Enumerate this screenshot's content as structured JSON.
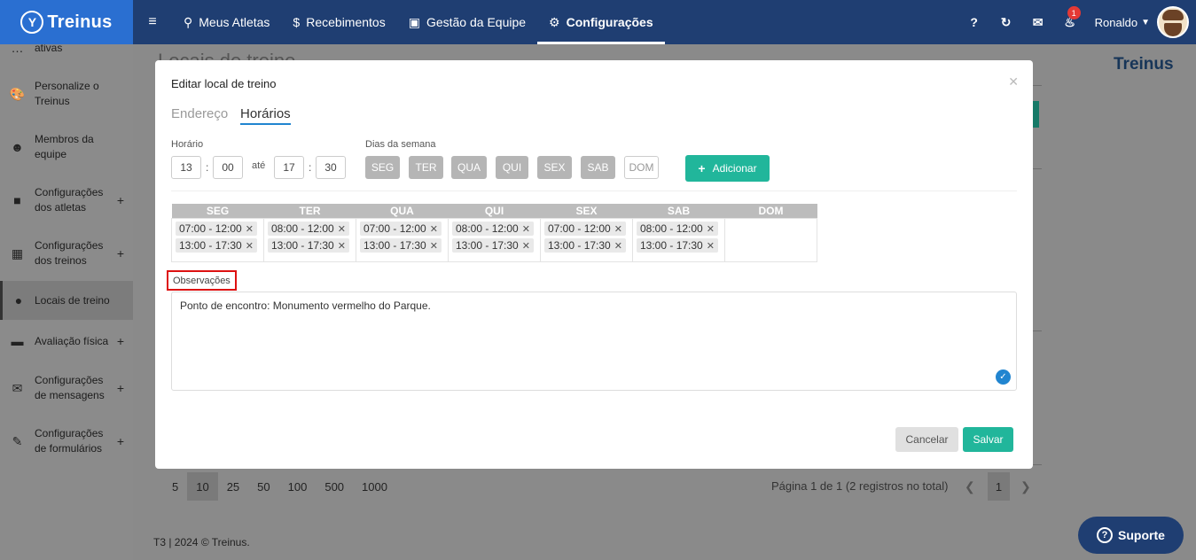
{
  "brand": {
    "name": "Treinus",
    "logo_icon": "treinus-logo-icon"
  },
  "nav": {
    "items": [
      {
        "label": "Meus Atletas",
        "icon": "medal-icon"
      },
      {
        "label": "Recebimentos",
        "icon": "dollar-icon"
      },
      {
        "label": "Gestão da Equipe",
        "icon": "id-card-icon"
      },
      {
        "label": "Configurações",
        "icon": "gears-icon"
      }
    ],
    "help": "?",
    "notifications_count": "1",
    "user_name": "Ronaldo"
  },
  "sidebar": {
    "items": [
      {
        "label": "ativas"
      },
      {
        "label": "Personalize o Treinus"
      },
      {
        "label": "Membros da equipe"
      },
      {
        "label": "Configurações dos atletas"
      },
      {
        "label": "Configurações dos treinos"
      },
      {
        "label": "Locais de treino"
      },
      {
        "label": "Avaliação física"
      },
      {
        "label": "Configurações de mensagens"
      },
      {
        "label": "Configurações de formulários"
      }
    ]
  },
  "background": {
    "title": "Locais de treino",
    "logo_text": "Treinus",
    "page_sizes": [
      "5",
      "10",
      "25",
      "50",
      "100",
      "500",
      "1000"
    ],
    "page_info": "Página 1 de 1 (2 registros no total)",
    "current_page": "1",
    "footer": "T3  | 2024 © Treinus.",
    "support": "Suporte"
  },
  "modal": {
    "title": "Editar local de treino",
    "tabs": [
      "Endereço",
      "Horários"
    ],
    "horario_label": "Horário",
    "start_hour": "13",
    "start_min": "00",
    "ate": "até",
    "end_hour": "17",
    "end_min": "30",
    "dias_label": "Dias da semana",
    "days": [
      "SEG",
      "TER",
      "QUA",
      "QUI",
      "SEX",
      "SAB",
      "DOM"
    ],
    "add_button": "Adicionar",
    "schedule": {
      "headers": [
        "SEG",
        "TER",
        "QUA",
        "QUI",
        "SEX",
        "SAB",
        "DOM"
      ],
      "slots": [
        [
          "07:00 - 12:00",
          "13:00 - 17:30"
        ],
        [
          "08:00 - 12:00",
          "13:00 - 17:30"
        ],
        [
          "07:00 - 12:00",
          "13:00 - 17:30"
        ],
        [
          "08:00 - 12:00",
          "13:00 - 17:30"
        ],
        [
          "07:00 - 12:00",
          "13:00 - 17:30"
        ],
        [
          "08:00 - 12:00",
          "13:00 - 17:30"
        ],
        []
      ]
    },
    "obs_label": "Observações",
    "obs_text": "Ponto de encontro: Monumento vermelho do Parque.",
    "cancel": "Cancelar",
    "save": "Salvar"
  },
  "colors": {
    "primary_nav": "#1f3e72",
    "brand": "#2a6fd1",
    "accent_green": "#21b69b",
    "highlight_border": "#dd1111"
  }
}
